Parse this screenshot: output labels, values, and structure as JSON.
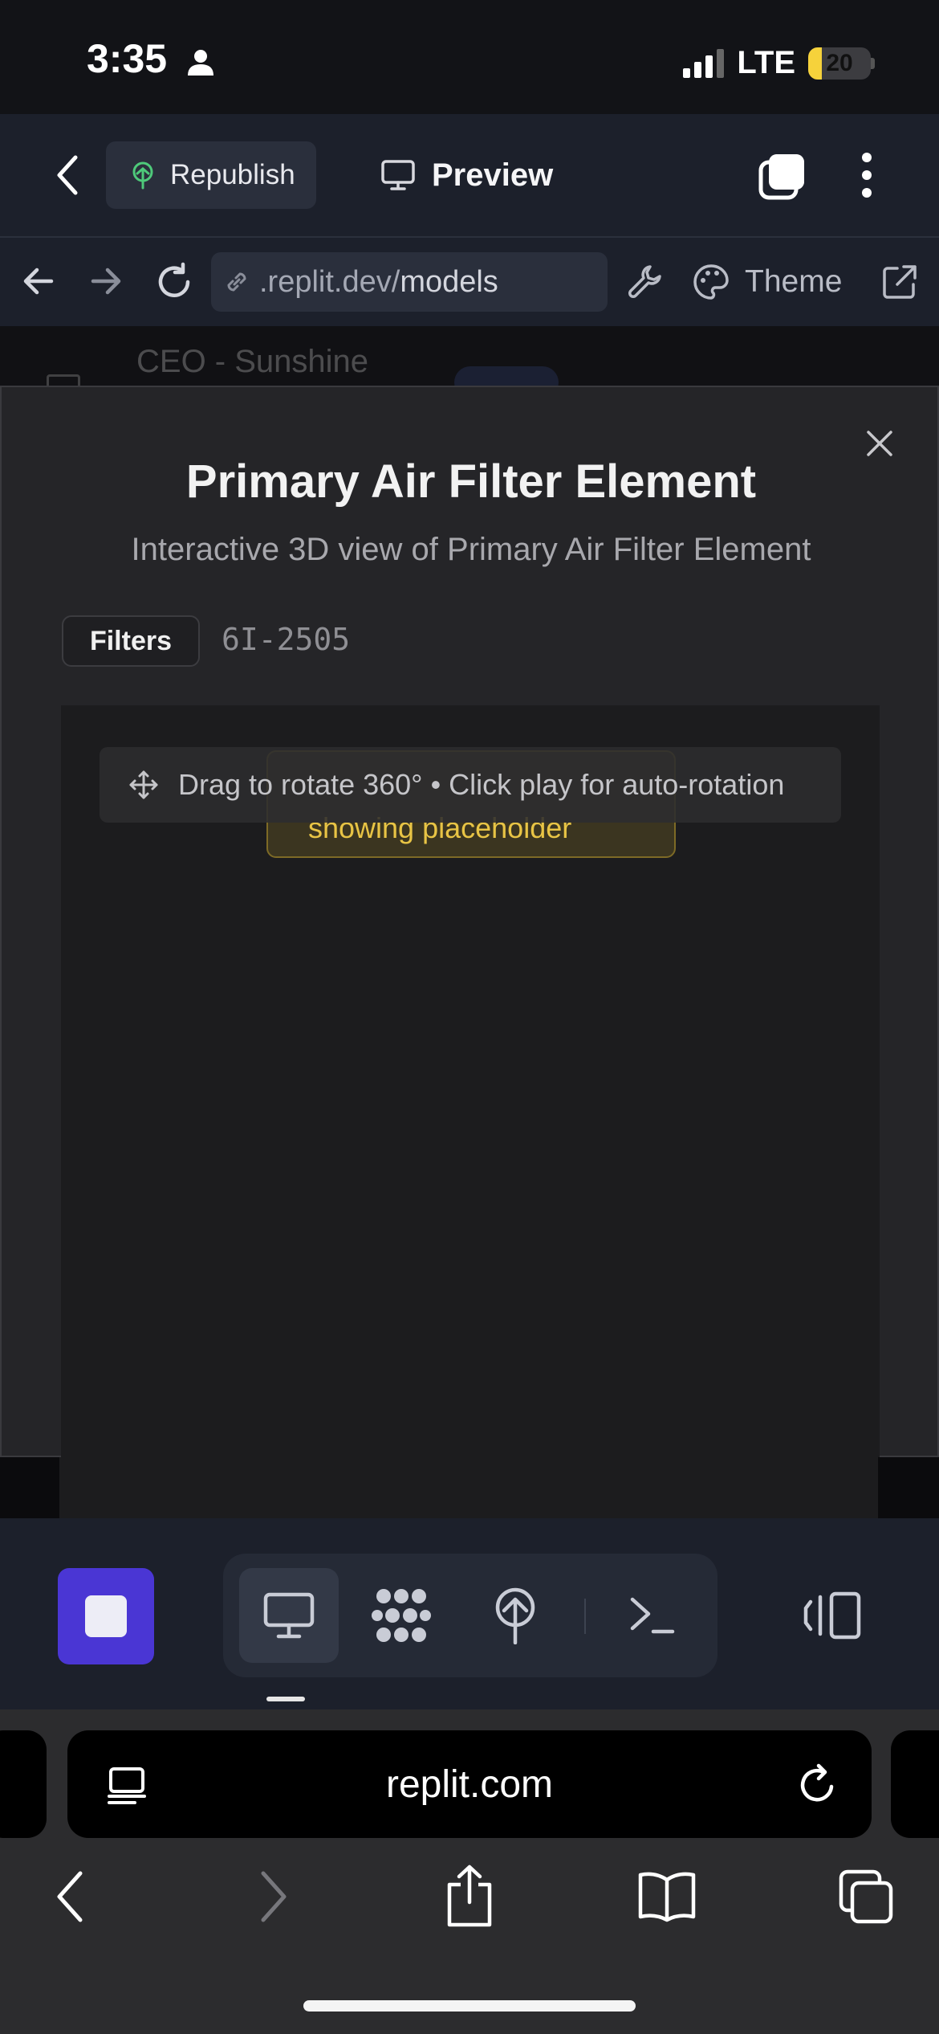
{
  "status_bar": {
    "time": "3:35",
    "network": "LTE",
    "battery_level": "20"
  },
  "header": {
    "republish_label": "Republish",
    "preview_label": "Preview"
  },
  "url_bar": {
    "url_prefix": ".replit.dev/",
    "url_path": "models",
    "theme_label": "Theme"
  },
  "background_page": {
    "row_title": "CEO - Sunshine"
  },
  "modal": {
    "title": "Primary Air Filter Element",
    "subtitle": "Interactive 3D view of Primary Air Filter Element",
    "category": "Filters",
    "part_number": "6I-2505",
    "warning_text": "showing placeholder",
    "hint": "Drag to rotate 360° • Click play for auto-rotation"
  },
  "safari": {
    "domain": "replit.com"
  },
  "colors": {
    "accent": "#4a36d4",
    "warning": "#e8c445",
    "republish_icon": "#4ec97a"
  }
}
